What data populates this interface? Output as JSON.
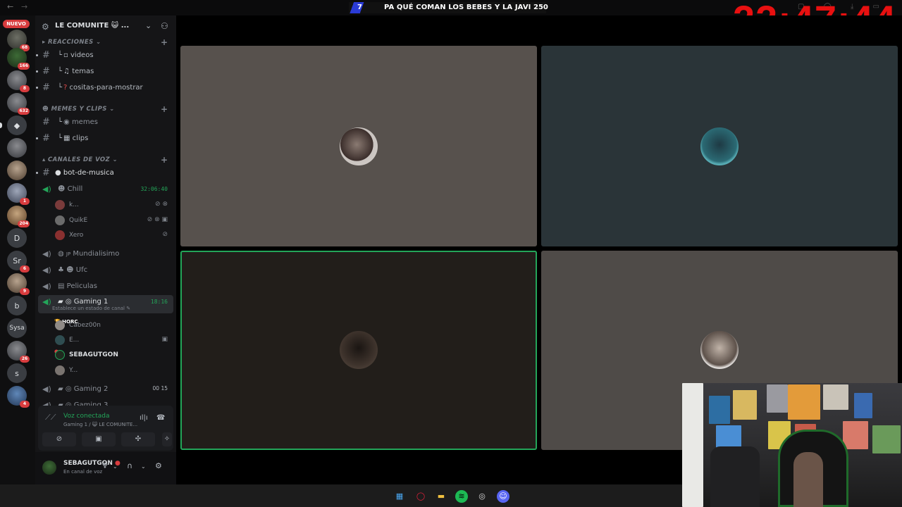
{
  "topbar": {
    "stream_number": "7",
    "stream_title": "PA QUÉ COMAN LOS BEBES Y LA JAVI",
    "stream_count": "250",
    "clock": "22:47:44"
  },
  "rail": {
    "nuevo_label": "NUEVO",
    "servers": [
      {
        "badge": "68"
      },
      {
        "badge": "166"
      },
      {
        "badge": "8"
      },
      {
        "badge": "632"
      },
      {
        "badge": ""
      },
      {
        "badge": ""
      },
      {
        "badge": ""
      },
      {
        "badge": "1"
      },
      {
        "badge": "204"
      },
      {
        "letter": "D"
      },
      {
        "letter": "Sr",
        "badge": "6"
      },
      {
        "badge": "9"
      },
      {
        "letter": "b"
      },
      {
        "letter": "Sysa"
      },
      {
        "badge": "26"
      },
      {
        "letter": "s"
      },
      {
        "badge": "4"
      }
    ]
  },
  "guild": {
    "name": "LE COMUNITE 😺 ..."
  },
  "categories": {
    "reacciones": "REACCIONES",
    "memes": "MEMES Y CLIPS",
    "voz": "CANALES DE VOZ"
  },
  "channels": {
    "videos": "videos",
    "temas": "temas",
    "cositas": "cositas-para-mostrar",
    "memes": "memes",
    "clips": "clips",
    "bot": "bot-de-musica",
    "chill": "Chill",
    "chill_time": "32:06:40",
    "mundialisimo": "Mundialisimo",
    "ufc": "Ufc",
    "peliculas": "Peliculas",
    "gaming1": "Gaming 1",
    "gaming1_time": "18:16",
    "gaming1_status": "Establece un estado de canal",
    "gaming2": "Gaming 2",
    "gaming2_count": "00  15",
    "gaming3": "Gaming 3"
  },
  "chill_users": [
    "k...",
    "QuikE",
    "Xero"
  ],
  "gaming1_users": {
    "u1": "Cabez00n",
    "u1_tag": "HORC",
    "u2": "E...",
    "u3": "SEBAGUTGON",
    "u4": "Y..."
  },
  "voice_panel": {
    "connected": "Voz conectada",
    "location": "Gaming 1 / 😺 LE COMUNITE..."
  },
  "userbar": {
    "name": "SEBAGUTGON",
    "status": "En canal de voz"
  },
  "colors": {
    "clock": "#e81010",
    "speaking": "#23a559",
    "tile1": "#57514d",
    "tile2": "#2a3438",
    "tile3": "#221e1a",
    "tile4": "#4f4b48"
  }
}
